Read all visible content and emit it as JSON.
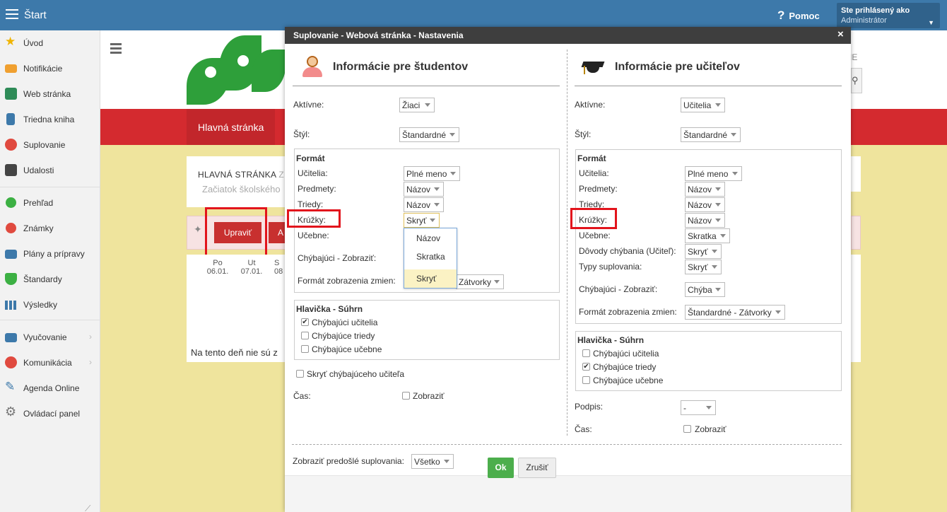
{
  "topbar": {
    "title": "Štart",
    "help": "Pomoc",
    "user_line1": "Ste prihlásený ako",
    "user_line2": "Administrátor"
  },
  "sidebar": {
    "items": [
      {
        "label": "Úvod"
      },
      {
        "label": "Notifikácie"
      },
      {
        "label": "Web stránka"
      },
      {
        "label": "Triedna kniha"
      },
      {
        "label": "Suplovanie"
      },
      {
        "label": "Udalosti"
      },
      {
        "label": "Prehľad"
      },
      {
        "label": "Známky"
      },
      {
        "label": "Plány a prípravy"
      },
      {
        "label": "Štandardy"
      },
      {
        "label": "Výsledky"
      },
      {
        "label": "Vyučovanie"
      },
      {
        "label": "Komunikácia"
      },
      {
        "label": "Agenda Online"
      },
      {
        "label": "Ovládací panel"
      }
    ]
  },
  "page": {
    "tab": "Hlavná stránka",
    "card_title": "HLAVNÁ STRÁNKA",
    "card_title_tail": "Z",
    "card_subtitle": "Začiatok školského",
    "edit_button": "Upraviť",
    "second_button": "A",
    "days": [
      {
        "name": "Po",
        "date": "06.01."
      },
      {
        "name": "Ut",
        "date": "07.01."
      },
      {
        "name": "S",
        "date": "08"
      }
    ],
    "no_entries": "Na tento deň nie sú z",
    "right_text": "IE"
  },
  "modal": {
    "title": "Suplovanie - Webová stránka - Nastavenia",
    "close": "×",
    "students": {
      "heading": "Informácie pre študentov",
      "active_label": "Aktívne:",
      "active_value": "Žiaci",
      "style_label": "Štýl:",
      "style_value": "Štandardné",
      "format_title": "Formát",
      "teachers_label": "Učitelia:",
      "teachers_value": "Plné meno",
      "subjects_label": "Predmety:",
      "subjects_value": "Názov",
      "classes_label": "Triedy:",
      "classes_value": "Názov",
      "circles_label": "Krúžky:",
      "circles_value": "Skryť",
      "rooms_label": "Učebne:",
      "missing_label": "Chýbajúci - Zobraziť:",
      "changes_label": "Formát zobrazenia zmien:",
      "changes_value": "Zátvorky",
      "summary_title": "Hlavička - Súhrn",
      "summary_items": [
        {
          "label": "Chýbajúci učitelia",
          "checked": "✔"
        },
        {
          "label": "Chýbajúce triedy",
          "checked": ""
        },
        {
          "label": "Chýbajúce učebne",
          "checked": ""
        }
      ],
      "hide_teacher": "Skryť chýbajúceho učiteľa",
      "time_label": "Čas:",
      "time_check": "Zobraziť",
      "dropdown_options": [
        "Názov",
        "Skratka",
        "Skryť"
      ]
    },
    "teachers": {
      "heading": "Informácie pre učiteľov",
      "active_label": "Aktívne:",
      "active_value": "Učitelia",
      "style_label": "Štýl:",
      "style_value": "Štandardné",
      "format_title": "Formát",
      "teachers_label": "Učitelia:",
      "teachers_value": "Plné meno",
      "subjects_label": "Predmety:",
      "subjects_value": "Názov",
      "classes_label": "Triedy:",
      "classes_value": "Názov",
      "circles_label": "Krúžky:",
      "circles_value": "Názov",
      "rooms_label": "Učebne:",
      "rooms_value": "Skratka",
      "reasons_label": "Dôvody chýbania (Učiteľ):",
      "reasons_value": "Skryť",
      "types_label": "Typy suplovania:",
      "types_value": "Skryť",
      "missing_label": "Chýbajúci - Zobraziť:",
      "missing_value": "Chýba",
      "changes_label": "Formát zobrazenia zmien:",
      "changes_value": "Štandardné - Zátvorky",
      "summary_title": "Hlavička - Súhrn",
      "summary_items": [
        {
          "label": "Chýbajúci učitelia",
          "checked": ""
        },
        {
          "label": "Chýbajúce triedy",
          "checked": "✔"
        },
        {
          "label": "Chýbajúce učebne",
          "checked": ""
        }
      ],
      "signature_label": "Podpis:",
      "signature_value": "-",
      "time_label": "Čas:",
      "time_check": "Zobraziť"
    },
    "previous_label": "Zobraziť predošlé suplovania:",
    "previous_value": "Všetko",
    "ok": "Ok",
    "cancel": "Zrušiť"
  },
  "colors": {
    "topbar": "#3d79aa",
    "red_band": "#d42a2f",
    "yellow_bg": "#efe49d",
    "highlight": "#e2141c",
    "ok_green": "#4cae4c"
  }
}
